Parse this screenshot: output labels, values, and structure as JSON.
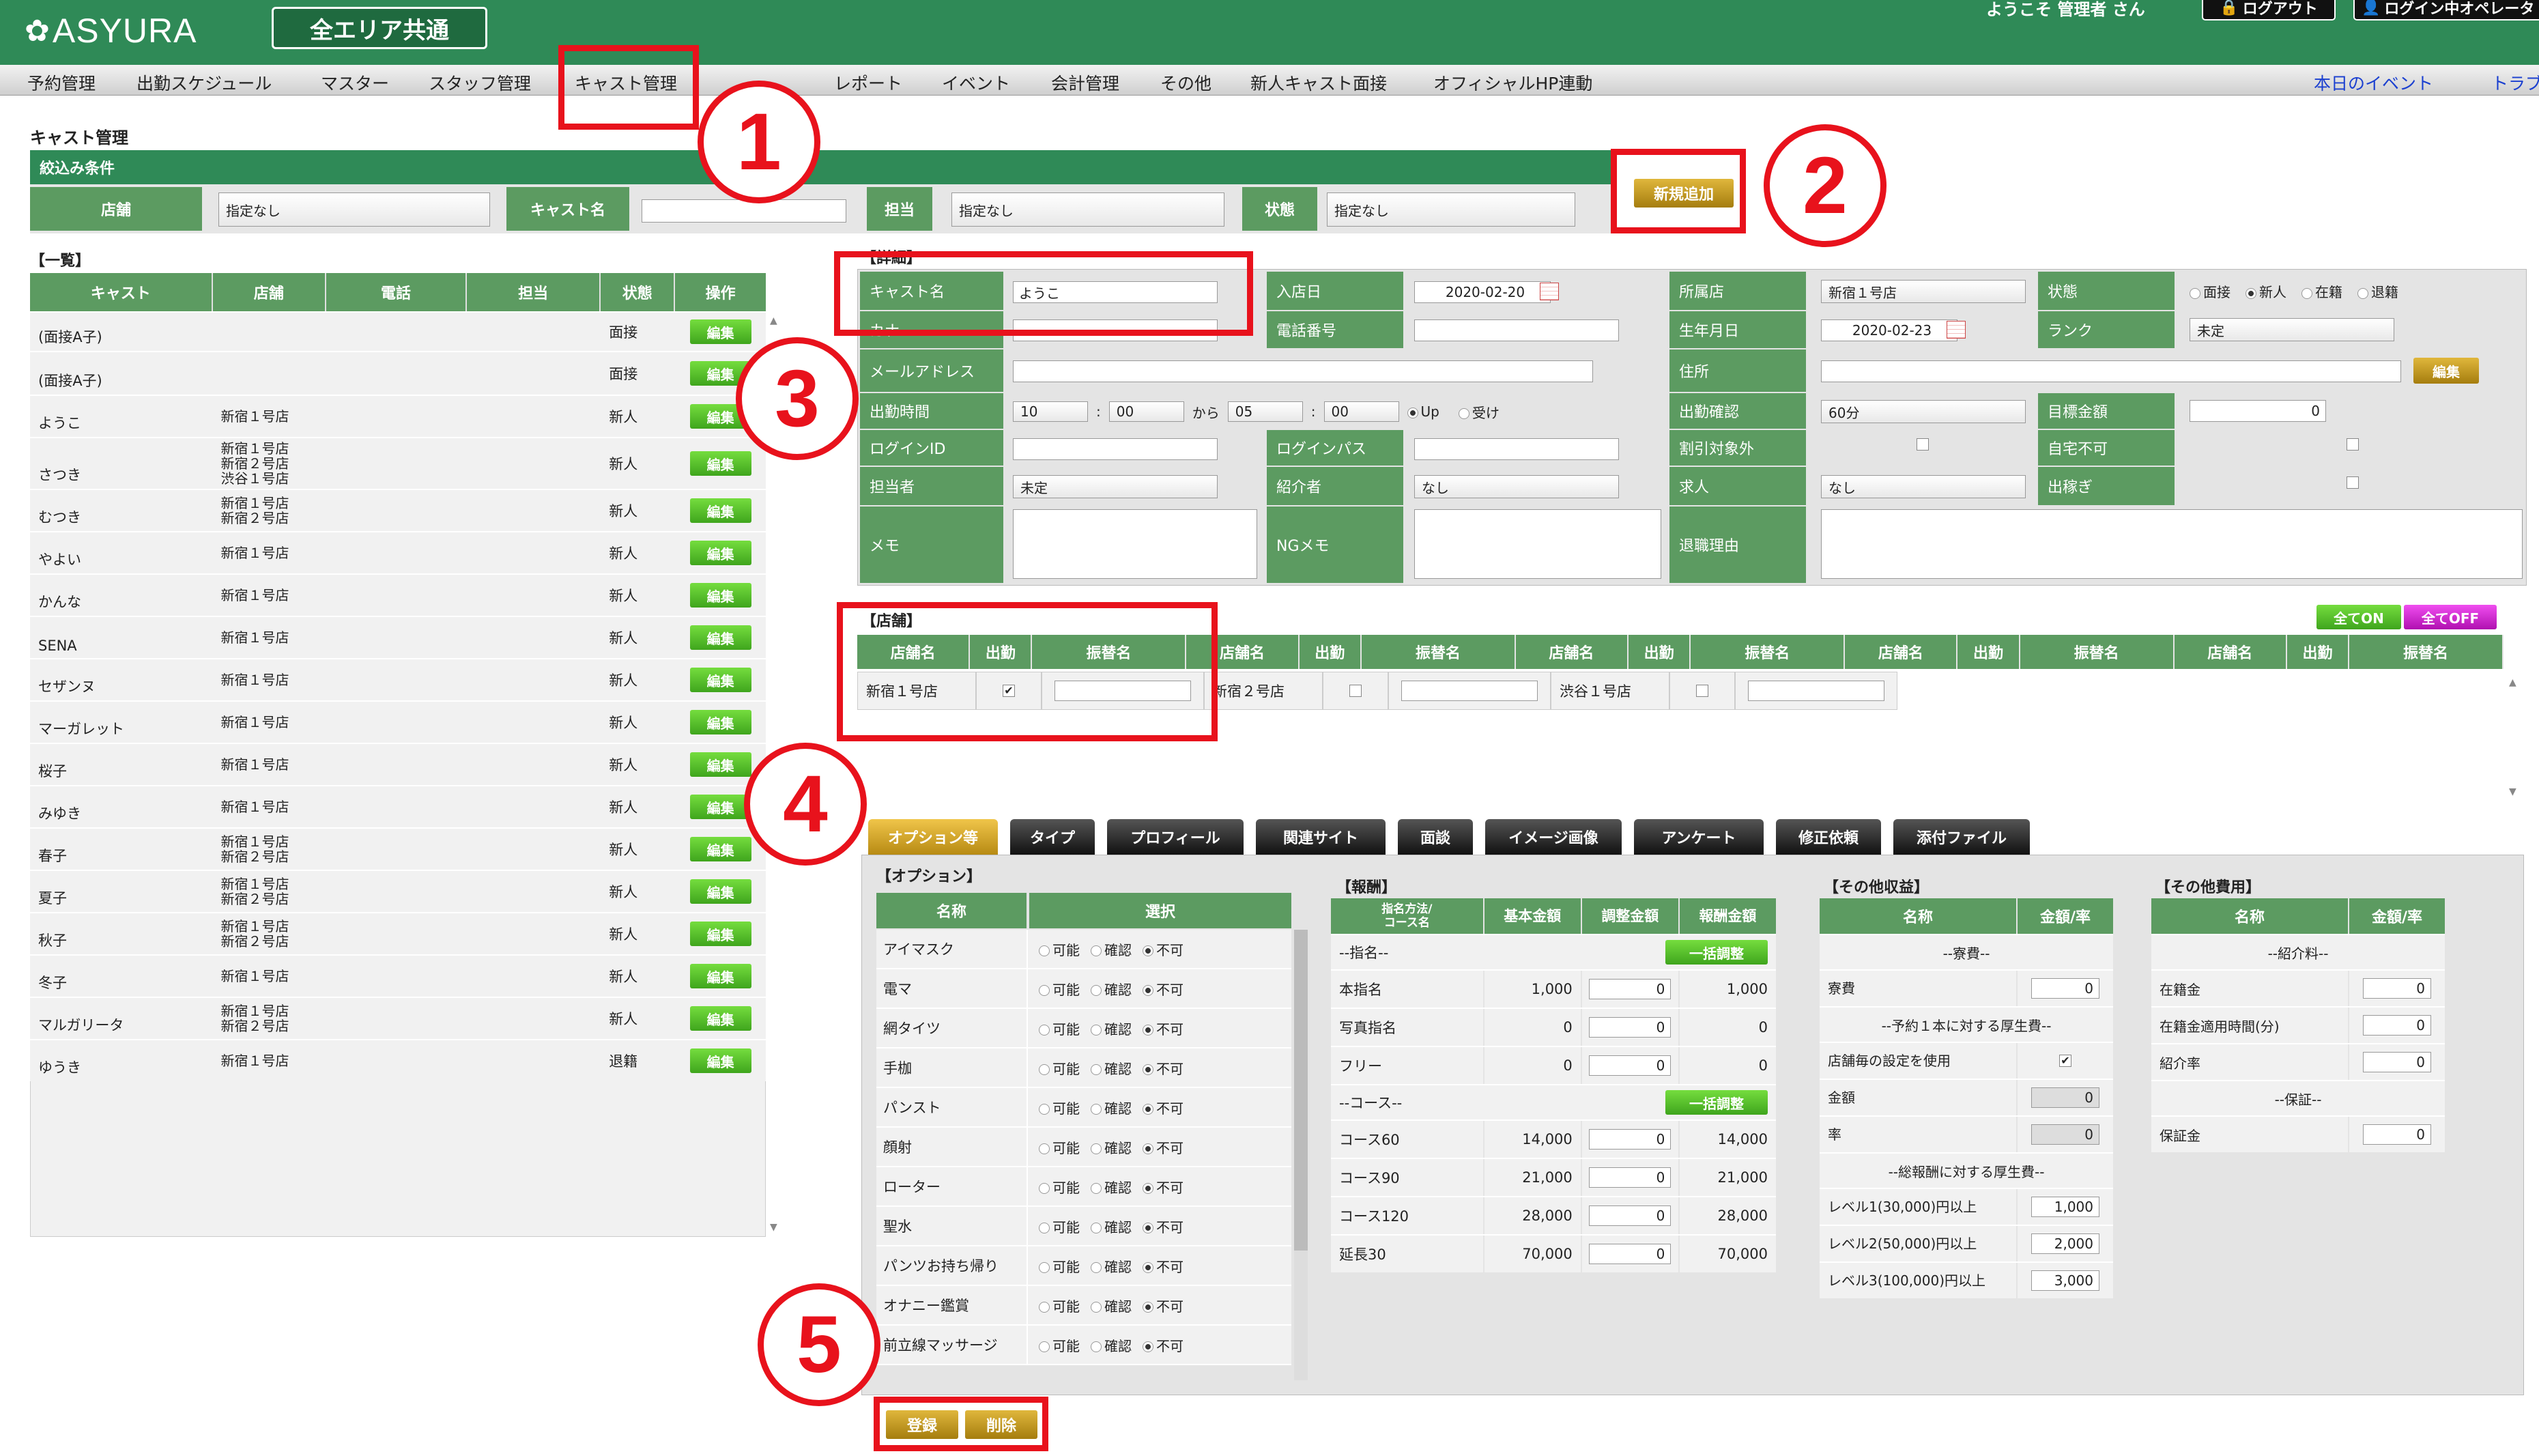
{
  "header": {
    "logo": "ASYURA",
    "area_button": "全エリア共通",
    "welcome": "ようこそ 管理者 さん",
    "logout": "ログアウト",
    "login_operator": "ログイン中オペレータ"
  },
  "menu": {
    "items": [
      "予約管理",
      "出勤スケジュール",
      "マスター",
      "スタッフ管理",
      "キャスト管理",
      "",
      "レポート",
      "イベント",
      "会計管理",
      "その他",
      "新人キャスト面接",
      "オフィシャルHP連動"
    ],
    "right_links": [
      "本日のイベント",
      "トラブ"
    ]
  },
  "page": {
    "title": "キャスト管理"
  },
  "filter": {
    "title": "絞込み条件",
    "store_label": "店舗",
    "store_value": "指定なし",
    "cast_label": "キャスト名",
    "cast_value": "",
    "tantou_label": "担当",
    "tantou_value": "指定なし",
    "status_label": "状態",
    "status_value": "指定なし",
    "new_button": "新規追加"
  },
  "list": {
    "title": "【一覧】",
    "headers": [
      "キャスト",
      "店舗",
      "電話",
      "担当",
      "状態",
      "操作"
    ],
    "edit_label": "編集",
    "rows": [
      {
        "cast": "(面接A子)",
        "store": "",
        "status": "面接"
      },
      {
        "cast": "(面接A子)",
        "store": "",
        "status": "面接"
      },
      {
        "cast": "ようこ",
        "store": "新宿１号店",
        "status": "新人"
      },
      {
        "cast": "さつき",
        "store": "新宿１号店\n新宿２号店\n渋谷１号店",
        "status": "新人"
      },
      {
        "cast": "むつき",
        "store": "新宿１号店\n新宿２号店",
        "status": "新人"
      },
      {
        "cast": "やよい",
        "store": "新宿１号店",
        "status": "新人"
      },
      {
        "cast": "かんな",
        "store": "新宿１号店",
        "status": "新人"
      },
      {
        "cast": "SENA",
        "store": "新宿１号店",
        "status": "新人"
      },
      {
        "cast": "セザンヌ",
        "store": "新宿１号店",
        "status": "新人"
      },
      {
        "cast": "マーガレット",
        "store": "新宿１号店",
        "status": "新人"
      },
      {
        "cast": "桜子",
        "store": "新宿１号店",
        "status": "新人"
      },
      {
        "cast": "みゆき",
        "store": "新宿１号店",
        "status": "新人"
      },
      {
        "cast": "春子",
        "store": "新宿１号店\n新宿２号店",
        "status": "新人"
      },
      {
        "cast": "夏子",
        "store": "新宿１号店\n新宿２号店",
        "status": "新人"
      },
      {
        "cast": "秋子",
        "store": "新宿１号店\n新宿２号店",
        "status": "新人"
      },
      {
        "cast": "冬子",
        "store": "新宿１号店",
        "status": "新人"
      },
      {
        "cast": "マルガリータ",
        "store": "新宿１号店\n新宿２号店",
        "status": "新人"
      },
      {
        "cast": "ゆうき",
        "store": "新宿１号店",
        "status": "退籍"
      }
    ]
  },
  "detail": {
    "title": "【詳細】",
    "cast_name_label": "キャスト名",
    "cast_name": "ようこ",
    "kana_label": "カナ",
    "kana": "",
    "email_label": "メールアドレス",
    "email": "",
    "shift_label": "出勤時間",
    "shift_from_h": "10",
    "shift_from_m": "00",
    "kara": "から",
    "shift_to_h": "05",
    "shift_to_m": "00",
    "up_label": "Up",
    "uke_label": "受け",
    "login_id_label": "ログインID",
    "login_id": "",
    "tantou_label": "担当者",
    "tantou": "未定",
    "memo_label": "メモ",
    "memo": "",
    "join_date_label": "入店日",
    "join_date": "2020-02-20",
    "phone_label": "電話番号",
    "phone": "",
    "login_pass_label": "ログインパス",
    "login_pass": "",
    "referrer_label": "紹介者",
    "referrer": "なし",
    "ng_memo_label": "NGメモ",
    "ng_memo": "",
    "store_label": "所属店",
    "store": "新宿１号店",
    "birthday_label": "生年月日",
    "birthday": "2020-02-23",
    "address_label": "住所",
    "address": "",
    "attendance_label": "出勤確認",
    "attendance": "60分",
    "discount_label": "割引対象外",
    "job_label": "求人",
    "job": "なし",
    "retire_label": "退職理由",
    "retire": "",
    "status_label": "状態",
    "status_options": [
      "面接",
      "新人",
      "在籍",
      "退籍"
    ],
    "status_selected": "新人",
    "rank_label": "ランク",
    "rank": "未定",
    "edit_button": "編集",
    "target_label": "目標金額",
    "target": "0",
    "home_label": "自宅不可",
    "dekasegi_label": "出稼ぎ"
  },
  "stores": {
    "title": "【店舗】",
    "all_on": "全てON",
    "all_off": "全てOFF",
    "col_store": "店舗名",
    "col_work": "出勤",
    "col_alias": "振替名",
    "items": [
      {
        "name": "新宿１号店",
        "checked": true
      },
      {
        "name": "新宿２号店",
        "checked": false
      },
      {
        "name": "渋谷１号店",
        "checked": false
      }
    ]
  },
  "tabs": [
    "オプション等",
    "タイプ",
    "プロフィール",
    "関連サイト",
    "面談",
    "イメージ画像",
    "アンケート",
    "修正依頼",
    "添付ファイル"
  ],
  "options": {
    "title": "【オプション】",
    "col_name": "名称",
    "col_select": "選択",
    "choices": [
      "可能",
      "確認",
      "不可"
    ],
    "items": [
      "アイマスク",
      "電マ",
      "網タイツ",
      "手枷",
      "パンスト",
      "顔射",
      "ローター",
      "聖水",
      "パンツお持ち帰り",
      "オナニー鑑賞",
      "前立線マッサージ"
    ]
  },
  "reward": {
    "title": "【報酬】",
    "headers": [
      "指名方法/\nコース名",
      "基本金額",
      "調整金額",
      "報酬金額"
    ],
    "bulk": "一括調整",
    "shimei_section": "--指名--",
    "course_section": "--コース--",
    "shimei": [
      {
        "name": "本指名",
        "base": "1,000",
        "adj": "0",
        "total": "1,000"
      },
      {
        "name": "写真指名",
        "base": "0",
        "adj": "0",
        "total": "0"
      },
      {
        "name": "フリー",
        "base": "0",
        "adj": "0",
        "total": "0"
      }
    ],
    "courses": [
      {
        "name": "コース60",
        "base": "14,000",
        "adj": "0",
        "total": "14,000"
      },
      {
        "name": "コース90",
        "base": "21,000",
        "adj": "0",
        "total": "21,000"
      },
      {
        "name": "コース120",
        "base": "28,000",
        "adj": "0",
        "total": "28,000"
      },
      {
        "name": "延長30",
        "base": "70,000",
        "adj": "0",
        "total": "70,000"
      }
    ]
  },
  "income": {
    "title": "【その他収益】",
    "headers": [
      "名称",
      "金額/率"
    ],
    "s1": "--寮費--",
    "dorm": "寮費",
    "dorm_v": "0",
    "s2": "--予約１本に対する厚生費--",
    "use_store": "店舗毎の設定を使用",
    "amount": "金額",
    "amount_v": "0",
    "rate": "率",
    "rate_v": "0",
    "s3": "--総報酬に対する厚生費--",
    "levels": [
      {
        "name": "レベル1(30,000)円以上",
        "v": "1,000"
      },
      {
        "name": "レベル2(50,000)円以上",
        "v": "2,000"
      },
      {
        "name": "レベル3(100,000)円以上",
        "v": "3,000"
      }
    ]
  },
  "expense": {
    "title": "【その他費用】",
    "headers": [
      "名称",
      "金額/率"
    ],
    "s1": "--紹介料--",
    "s2": "--保証--",
    "items": [
      {
        "name": "在籍金",
        "v": "0"
      },
      {
        "name": "在籍金適用時間(分)",
        "v": "0"
      },
      {
        "name": "紹介率",
        "v": "0"
      }
    ],
    "guarantee": "保証金",
    "guarantee_v": "0"
  },
  "actions": {
    "register": "登録",
    "delete": "削除"
  },
  "callouts": [
    "1",
    "2",
    "3",
    "4",
    "5"
  ],
  "colors": {
    "brand_green": "#2f8a57",
    "header_green": "#5c9b61",
    "callout_red": "#e8121c"
  }
}
